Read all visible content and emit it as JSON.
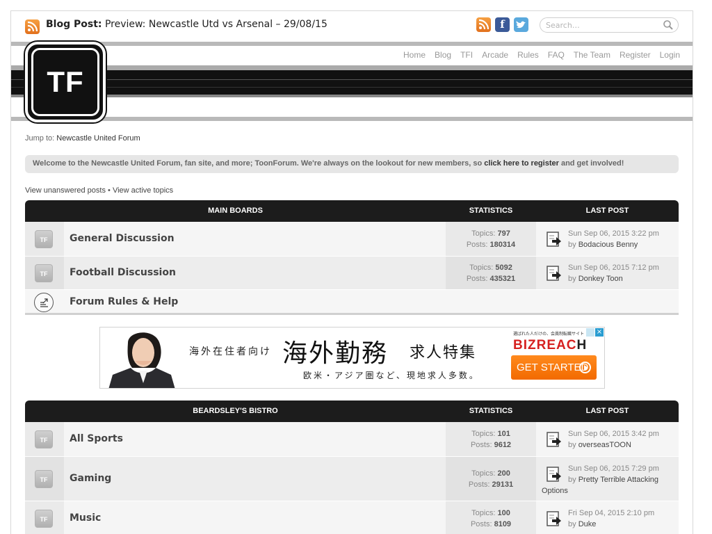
{
  "header": {
    "blog_label": "Blog Post:",
    "blog_title": " Preview: Newcastle Utd vs Arsenal – 29/08/15",
    "search_placeholder": "Search…",
    "social": {
      "rss_icon": "rss-icon",
      "facebook_glyph": "f",
      "twitter_icon": "twitter-bird-icon"
    }
  },
  "logo": {
    "text": "TF"
  },
  "nav": [
    "Home",
    "Blog",
    "TFI",
    "Arcade",
    "Rules",
    "FAQ",
    "The Team",
    "Register",
    "Login"
  ],
  "jump": {
    "label": "Jump to:",
    "link": "Newcastle United Forum"
  },
  "welcome": {
    "text_before": "Welcome to the Newcastle United Forum, fan site, and more; ToonForum. We're always on the lookout for new members, so ",
    "link": "click here to register",
    "text_after": " and get involved!"
  },
  "links": {
    "unanswered": "View unanswered posts",
    "separator": " • ",
    "active": "View active topics"
  },
  "main_boards": {
    "header": "MAIN BOARDS",
    "stats_header": "STATISTICS",
    "last_header": "LAST POST",
    "rows": [
      {
        "icon": "TF",
        "name": "General Discussion",
        "topics_label": "Topics:",
        "topics": "797",
        "posts_label": "Posts:",
        "posts": "180314",
        "last_date": "Sun Sep 06, 2015 3:22 pm",
        "last_by": "by",
        "last_user": "Bodacious Benny"
      },
      {
        "icon": "TF",
        "name": "Football Discussion",
        "topics_label": "Topics:",
        "topics": "5092",
        "posts_label": "Posts:",
        "posts": "435321",
        "last_date": "Sun Sep 06, 2015 7:12 pm",
        "last_by": "by",
        "last_user": "Donkey Toon"
      },
      {
        "name": "Forum Rules & Help"
      }
    ]
  },
  "ad": {
    "line1": "海外在住者向け",
    "line2": "海外勤務",
    "line3": "求人特集",
    "line4": "欧米・アジア圏など、現地求人多数。",
    "brand_small": "選ばれた人だけの、会員制転職サイト",
    "brand_red": "BIZREAC",
    "brand_rest": "H",
    "cta": "GET STARTED",
    "close": "×"
  },
  "bistro": {
    "header": "BEARDSLEY'S BISTRO",
    "stats_header": "STATISTICS",
    "last_header": "LAST POST",
    "rows": [
      {
        "icon": "TF",
        "name": "All Sports",
        "topics_label": "Topics:",
        "topics": "101",
        "posts_label": "Posts:",
        "posts": "9612",
        "last_date": "Sun Sep 06, 2015 3:42 pm",
        "last_by": "by",
        "last_user": "overseasTOON"
      },
      {
        "icon": "TF",
        "name": "Gaming",
        "topics_label": "Topics:",
        "topics": "200",
        "posts_label": "Posts:",
        "posts": "29131",
        "last_date": "Sun Sep 06, 2015 7:29 pm",
        "last_by": "by",
        "last_user": "Pretty Terrible Attacking",
        "last_user_cont": "Options"
      },
      {
        "icon": "TF",
        "name": "Music",
        "topics_label": "Topics:",
        "topics": "100",
        "posts_label": "Posts:",
        "posts": "8109",
        "last_date": "Fri Sep 04, 2015 2:10 pm",
        "last_by": "by",
        "last_user": "Duke"
      }
    ]
  },
  "colors": {
    "header_bg": "#1c1c1c",
    "rss": "#e2711d",
    "facebook": "#3b5a98",
    "twitter": "#5aa9dd",
    "cta": "#f26a00",
    "bizreach_red": "#d6201f"
  }
}
